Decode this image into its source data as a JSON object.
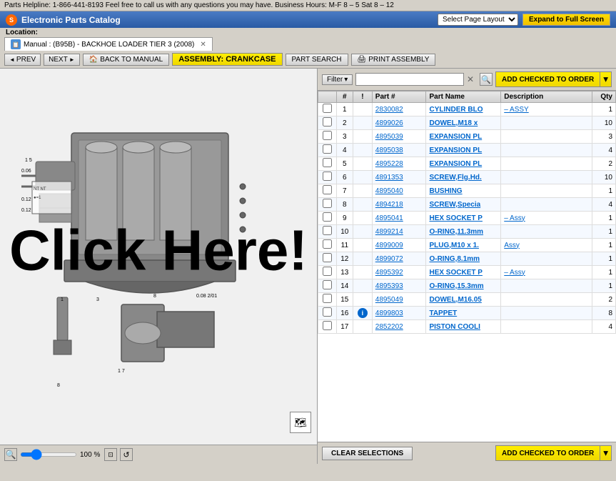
{
  "topbar": {
    "helpline": "Parts Helpline: 1-866-441-8193  Feel free to call us with any questions you may have. Business Hours: M-F 8 – 5  Sat 8 – 12"
  },
  "titlebar": {
    "logo": "S",
    "title": "Electronic Parts Catalog",
    "page_layout_label": "Select Page Layout",
    "expand_btn": "Expand to Full Screen"
  },
  "location": {
    "label": "Location:",
    "manual_tab": "Manual : (B95B) - BACKHOE LOADER TIER 3 (2008)"
  },
  "nav": {
    "prev_btn": "PREV",
    "next_btn": "NEXT",
    "back_btn": "BACK TO MANUAL",
    "assembly_btn": "ASSEMBLY: CRANKCASE",
    "part_search_btn": "PART SEARCH",
    "print_btn": "PRINT ASSEMBLY"
  },
  "filter": {
    "label": "Filter",
    "placeholder": "",
    "add_checked_btn": "ADD CHECKED TO ORDER"
  },
  "table": {
    "headers": [
      "",
      "#",
      "!",
      "Part #",
      "Part Name",
      "Description",
      "Qty"
    ],
    "rows": [
      {
        "num": "1",
        "warn": "",
        "part_no": "2830082",
        "part_name": "CYLINDER BLO",
        "desc": "– ASSY",
        "qty": "1"
      },
      {
        "num": "2",
        "warn": "",
        "part_no": "4899026",
        "part_name": "DOWEL,M18 x",
        "desc": "",
        "qty": "10"
      },
      {
        "num": "3",
        "warn": "",
        "part_no": "4895039",
        "part_name": "EXPANSION PL",
        "desc": "",
        "qty": "3"
      },
      {
        "num": "4",
        "warn": "",
        "part_no": "4895038",
        "part_name": "EXPANSION PL",
        "desc": "",
        "qty": "4"
      },
      {
        "num": "5",
        "warn": "",
        "part_no": "4895228",
        "part_name": "EXPANSION PL",
        "desc": "",
        "qty": "2"
      },
      {
        "num": "6",
        "warn": "",
        "part_no": "4891353",
        "part_name": "SCREW,Flg.Hd.",
        "desc": "",
        "qty": "10"
      },
      {
        "num": "7",
        "warn": "",
        "part_no": "4895040",
        "part_name": "BUSHING",
        "desc": "",
        "qty": "1"
      },
      {
        "num": "8",
        "warn": "",
        "part_no": "4894218",
        "part_name": "SCREW,Specia",
        "desc": "",
        "qty": "4"
      },
      {
        "num": "9",
        "warn": "",
        "part_no": "4895041",
        "part_name": "HEX SOCKET P",
        "desc": "– Assy",
        "qty": "1"
      },
      {
        "num": "10",
        "warn": "",
        "part_no": "4899214",
        "part_name": "O-RING,11.3mm",
        "desc": "",
        "qty": "1"
      },
      {
        "num": "11",
        "warn": "",
        "part_no": "4899009",
        "part_name": "PLUG,M10 x 1.",
        "desc": "Assy",
        "qty": "1"
      },
      {
        "num": "12",
        "warn": "",
        "part_no": "4899072",
        "part_name": "O-RING,8.1mm",
        "desc": "",
        "qty": "1"
      },
      {
        "num": "13",
        "warn": "",
        "part_no": "4895392",
        "part_name": "HEX SOCKET P",
        "desc": "– Assy",
        "qty": "1"
      },
      {
        "num": "14",
        "warn": "",
        "part_no": "4895393",
        "part_name": "O-RING,15.3mm",
        "desc": "",
        "qty": "1"
      },
      {
        "num": "15",
        "warn": "",
        "part_no": "4895049",
        "part_name": "DOWEL,M16.05",
        "desc": "",
        "qty": "2"
      },
      {
        "num": "16",
        "warn": "!",
        "part_no": "4899803",
        "part_name": "TAPPET",
        "desc": "",
        "qty": "8"
      },
      {
        "num": "17",
        "warn": "",
        "part_no": "2852202",
        "part_name": "PISTON COOLI",
        "desc": "",
        "qty": "4"
      }
    ]
  },
  "bottom": {
    "clear_btn": "CLEAR SELECTIONS",
    "add_order_btn": "ADD CHECKED TO ORDER"
  },
  "zoom": {
    "percent": "100 %"
  },
  "click_here": "Click Here!"
}
